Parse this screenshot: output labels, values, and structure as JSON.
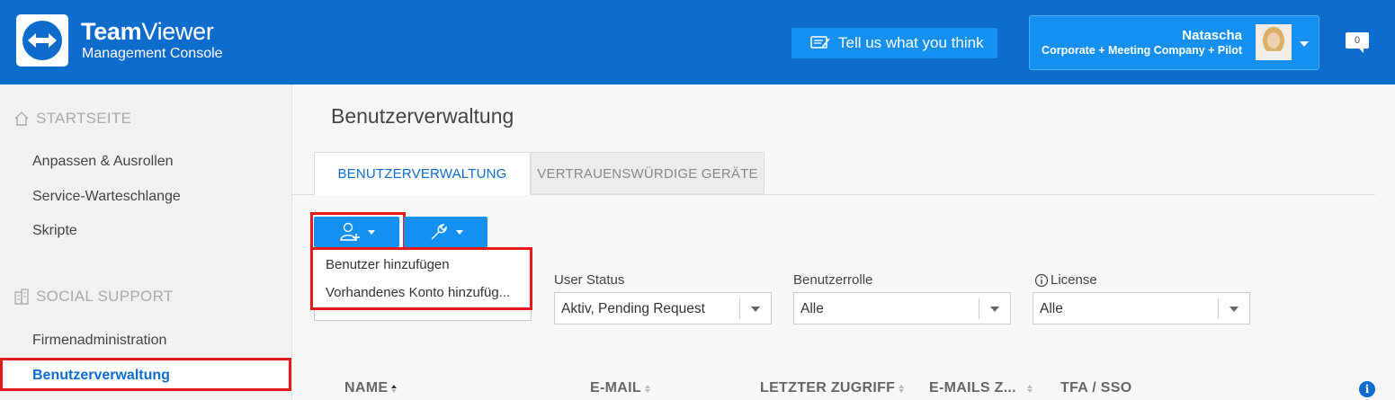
{
  "header": {
    "brand_bold": "Team",
    "brand_rest": "Viewer",
    "brand_sub": "Management Console",
    "feedback_label": "Tell us what you think",
    "user_name": "Natascha",
    "user_plan": "Corporate + Meeting Company + Pilot",
    "notification_count": "0",
    "accent_color": "#0e6ccc"
  },
  "sidebar": {
    "section1": "STARTSEITE",
    "items1": [
      "Anpassen & Ausrollen",
      "Service-Warteschlange",
      "Skripte"
    ],
    "section2": "SOCIAL SUPPORT",
    "items2": [
      "Firmenadministration",
      "Benutzerverwaltung"
    ]
  },
  "main": {
    "title": "Benutzerverwaltung",
    "tabs": [
      "BENUTZERVERWALTUNG",
      "VERTRAUENSWÜRDIGE GERÄTE"
    ],
    "dropdown": [
      "Benutzer hinzufügen",
      "Vorhandenes Konto hinzufüg..."
    ],
    "filters": [
      {
        "label": "User Status",
        "value": "Aktiv, Pending Request"
      },
      {
        "label": "Benutzerrolle",
        "value": "Alle"
      },
      {
        "label": "License",
        "value": "Alle"
      }
    ],
    "columns": [
      "NAME",
      "E-MAIL",
      "LETZTER ZUGRIFF",
      "E-MAILS Z...",
      "TFA / SSO"
    ],
    "highlight_color": "#e31b1b"
  }
}
